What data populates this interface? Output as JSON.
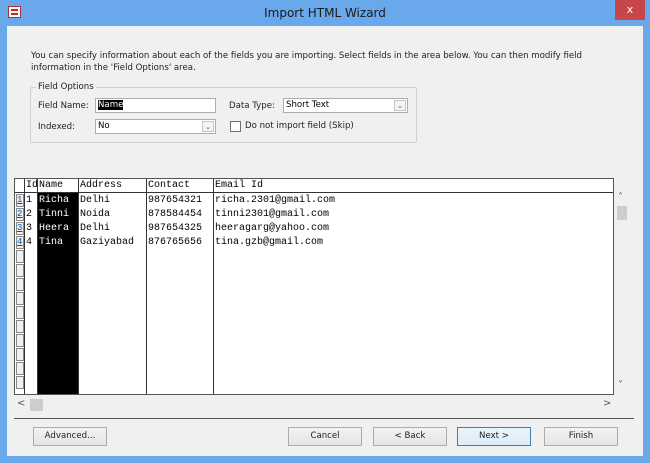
{
  "window": {
    "title": "Import HTML Wizard",
    "close": "x"
  },
  "intro": "You can specify information about each of the fields you are importing. Select fields in the area below. You can then modify field information in the 'Field Options' area.",
  "field_options": {
    "legend": "Field Options",
    "field_name_label": "Field Name:",
    "field_name_value": "Name",
    "data_type_label": "Data Type:",
    "data_type_value": "Short Text",
    "indexed_label": "Indexed:",
    "indexed_value": "No",
    "skip_label": "Do not import field (Skip)",
    "skip_checked": false
  },
  "grid": {
    "headers": [
      "Id",
      "Name",
      "Address",
      "Contact",
      "Email Id"
    ],
    "rows": [
      {
        "sel": "1",
        "id": "1",
        "name": "Richa",
        "address": "Delhi",
        "contact": "987654321",
        "email": "richa.2301@gmail.com"
      },
      {
        "sel": "2",
        "id": "2",
        "name": "Tinni",
        "address": "Noida",
        "contact": "878584454",
        "email": "tinni2301@gmail.com"
      },
      {
        "sel": "3",
        "id": "3",
        "name": "Heera",
        "address": "Delhi",
        "contact": "987654325",
        "email": "heeragarg@yahoo.com"
      },
      {
        "sel": "4",
        "id": "4",
        "name": "Tina",
        "address": "Gaziyabad",
        "contact": "876765656",
        "email": "tina.gzb@gmail.com"
      }
    ]
  },
  "buttons": {
    "advanced": "Advanced...",
    "cancel": "Cancel",
    "back": "< Back",
    "next": "Next >",
    "finish": "Finish"
  },
  "scroll": {
    "up": "˄",
    "down": "˅",
    "left": "<",
    "right": ">"
  }
}
